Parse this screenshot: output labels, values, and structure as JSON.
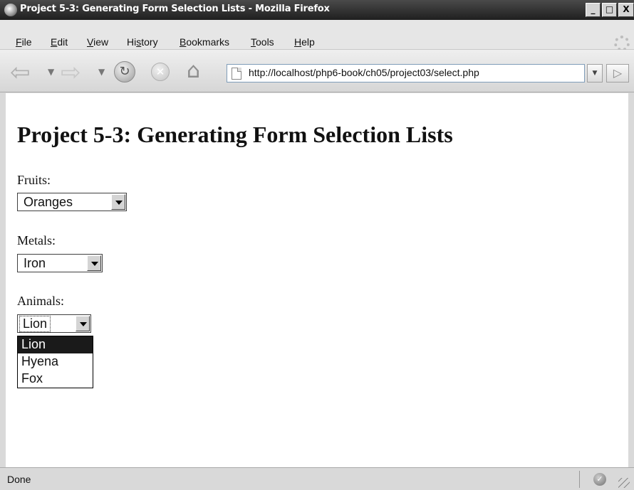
{
  "window": {
    "title": "Project 5-3: Generating Form Selection Lists - Mozilla Firefox",
    "minimize_label": "_",
    "maximize_label": "□",
    "close_label": "X"
  },
  "menu": {
    "items": [
      {
        "acc": "F",
        "rest": "ile"
      },
      {
        "acc": "E",
        "rest": "dit"
      },
      {
        "acc": "V",
        "rest": "iew"
      },
      {
        "pre": "Hi",
        "acc": "s",
        "rest": "tory"
      },
      {
        "acc": "B",
        "rest": "ookmarks"
      },
      {
        "acc": "T",
        "rest": "ools"
      },
      {
        "acc": "H",
        "rest": "elp"
      }
    ]
  },
  "nav": {
    "url": "http://localhost/php6-book/ch05/project03/select.php"
  },
  "page": {
    "heading": "Project 5-3: Generating Form Selection Lists",
    "fruits": {
      "label": "Fruits:",
      "selected": "Oranges"
    },
    "metals": {
      "label": "Metals:",
      "selected": "Iron"
    },
    "animals": {
      "label": "Animals:",
      "selected": "Lion",
      "options": [
        "Lion",
        "Hyena",
        "Fox"
      ]
    }
  },
  "status": {
    "text": "Done"
  }
}
